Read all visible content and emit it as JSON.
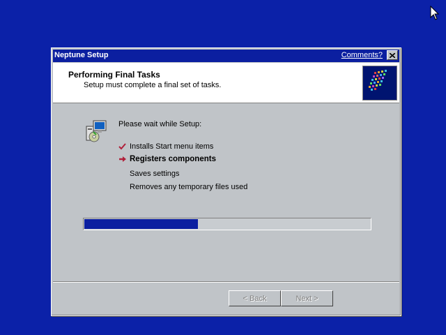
{
  "window": {
    "title": "Neptune Setup",
    "comments_link": "Comments?"
  },
  "header": {
    "title": "Performing Final Tasks",
    "subtitle": "Setup must complete a final set of tasks."
  },
  "main": {
    "intro": "Please wait while Setup:",
    "tasks": [
      {
        "label": "Installs Start menu items",
        "status": "done"
      },
      {
        "label": "Registers components",
        "status": "current"
      },
      {
        "label": "Saves settings",
        "status": "pending"
      },
      {
        "label": "Removes any temporary files used",
        "status": "pending"
      }
    ],
    "progress_fraction": 0.4
  },
  "buttons": {
    "back": "< Back",
    "next": "Next >"
  },
  "colors": {
    "desktop": "#0b21a8",
    "titlebar": "#0b1fa0",
    "progress": "#0b1fa0",
    "check": "#b0203a"
  }
}
